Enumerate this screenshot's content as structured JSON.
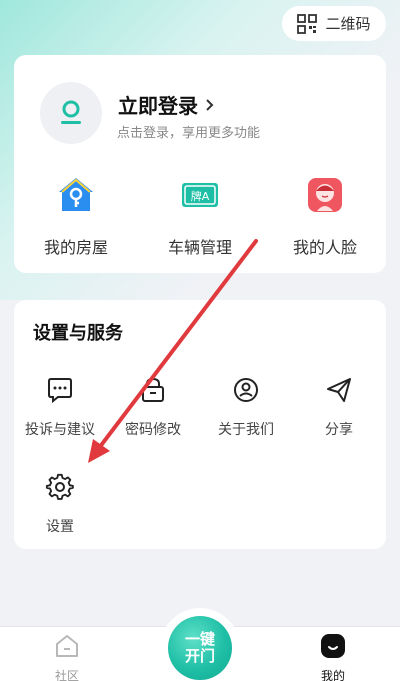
{
  "header": {
    "qr_label": "二维码"
  },
  "user": {
    "login_title": "立即登录",
    "login_subtitle": "点击登录，享用更多功能"
  },
  "features": [
    {
      "label": "我的房屋",
      "icon": "house-key-icon"
    },
    {
      "label": "车辆管理",
      "icon": "license-plate-icon"
    },
    {
      "label": "我的人脸",
      "icon": "face-icon"
    }
  ],
  "services": {
    "title": "设置与服务",
    "items": [
      {
        "label": "投诉与建议",
        "icon": "chat-bubble-icon"
      },
      {
        "label": "密码修改",
        "icon": "lock-icon"
      },
      {
        "label": "关于我们",
        "icon": "user-circle-icon"
      },
      {
        "label": "分享",
        "icon": "paper-plane-icon"
      },
      {
        "label": "设置",
        "icon": "gear-icon"
      }
    ]
  },
  "tabbar": {
    "community_label": "社区",
    "center_line1": "一键",
    "center_line2": "开门",
    "mine_label": "我的"
  },
  "colors": {
    "accent": "#1fbfa6",
    "arrow": "#e03a3e",
    "house_icon": "#2a8df0",
    "face_icon": "#f0565f"
  }
}
